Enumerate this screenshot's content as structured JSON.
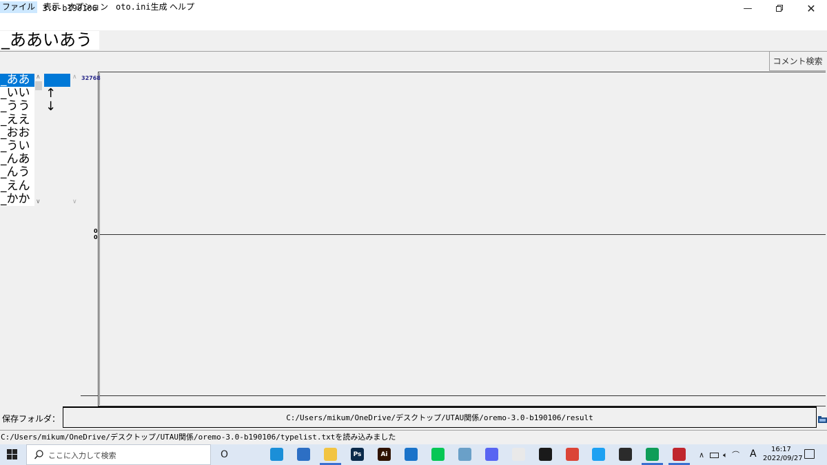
{
  "window": {
    "title": "OREMO 3.0-b190106",
    "minimize_icon": "minimize-icon",
    "restore_icon": "restore-icon",
    "close_icon": "close-icon"
  },
  "menu": {
    "items": [
      "ファイル",
      "表示",
      "オプション",
      "oto.ini生成",
      "ヘルプ"
    ]
  },
  "current_recording": "_ああいあう",
  "comment_button": "コメント検索",
  "word_list": {
    "items": [
      "_ああ",
      "_いい",
      "_うう",
      "_ええ",
      "_おお",
      "_うい",
      "_んあ",
      "_んう",
      "_えん",
      "_かか"
    ],
    "selected_index": 0
  },
  "arrow_list": {
    "items": [
      "↑",
      "↓"
    ]
  },
  "waveform": {
    "max_label": "32768",
    "zero_label_1": "0",
    "zero_label_2": "0"
  },
  "save_folder": {
    "label": "保存フォルダ：",
    "path": "C:/Users/mikum/OneDrive/デスクトップ/UTAU関係/oremo-3.0-b190106/result"
  },
  "status_text": "C:/Users/mikum/OneDrive/デスクトップ/UTAU関係/oremo-3.0-b190106/typelist.txtを読み込みました",
  "taskbar": {
    "search_placeholder": "ここに入力して検索",
    "ime_indicator": "A",
    "time": "16:17",
    "date": "2022/09/27",
    "apps": [
      {
        "name": "cortana-icon",
        "label": "O",
        "color": "#dde7f4"
      },
      {
        "name": "task-view-icon",
        "label": "",
        "color": "#dde7f4"
      },
      {
        "name": "edge-icon",
        "label": "",
        "color": "#1b8fd8"
      },
      {
        "name": "store-icon",
        "label": "",
        "color": "#2d6fc4"
      },
      {
        "name": "file-explorer-icon",
        "label": "",
        "color": "#f2c442"
      },
      {
        "name": "photoshop-icon",
        "label": "Ps",
        "color": "#0b2a4a"
      },
      {
        "name": "illustrator-icon",
        "label": "Ai",
        "color": "#2f1200"
      },
      {
        "name": "mail-icon",
        "label": "",
        "color": "#1a73c9"
      },
      {
        "name": "line-icon",
        "label": "",
        "color": "#06c755"
      },
      {
        "name": "app-icon",
        "label": "",
        "color": "#6aa0c8"
      },
      {
        "name": "discord-icon",
        "label": "",
        "color": "#5865f2"
      },
      {
        "name": "paint-icon",
        "label": "",
        "color": "#e9e9e9"
      },
      {
        "name": "clip-studio-icon",
        "label": "",
        "color": "#1a1a1a"
      },
      {
        "name": "chrome-icon",
        "label": "",
        "color": "#db4437"
      },
      {
        "name": "twitter-icon",
        "label": "",
        "color": "#1da1f2"
      },
      {
        "name": "sticky-notes-icon",
        "label": "",
        "color": "#2b2b2b"
      },
      {
        "name": "chrome-2-icon",
        "label": "",
        "color": "#0f9d58"
      },
      {
        "name": "oremo-icon",
        "label": "",
        "color": "#c0262d"
      }
    ]
  }
}
